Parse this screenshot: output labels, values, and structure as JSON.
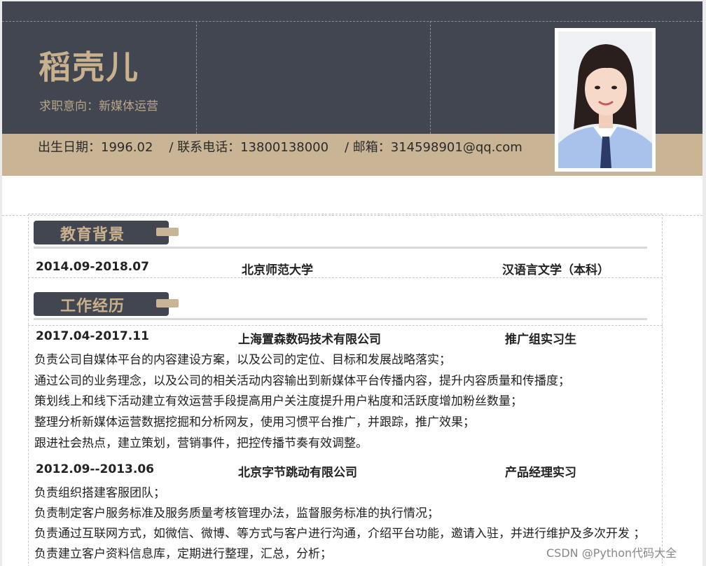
{
  "header": {
    "name": "稻壳儿",
    "intent": "求职意向：新媒体运营",
    "info": "出生日期：1996.02    / 联系电话：13800138000    / 邮箱：314598901@qq.com"
  },
  "education": {
    "title": "教育背景",
    "date": "2014.09-2018.07",
    "school": "北京师范大学",
    "major": "汉语言文学（本科）"
  },
  "work": {
    "title": "工作经历",
    "jobs": [
      {
        "date": "2017.04-2017.11",
        "company": "上海置森数码技术有限公司",
        "role": "推广组实习生",
        "lines": [
          "负责公司自媒体平台的内容建设方案，以及公司的定位、目标和发展战略落实；",
          "通过公司的业务理念，以及公司的相关活动内容输出到新媒体平台传播内容，提升内容质量和传播度；",
          "策划线上和线下活动建立有效运营手段提高用户关注度提升用户粘度和活跃度增加粉丝数量；",
          "整理分析新媒体运营数据挖掘和分析网友，使用习惯平台推广，并跟踪，推广效果；",
          "跟进社会热点，建立策划，营销事件，把控传播节奏有效调整。"
        ]
      },
      {
        "date": "2012.09--2013.06",
        "company": "北京字节跳动有限公司",
        "role": "产品经理实习",
        "lines": [
          "负责组织搭建客服团队；",
          "负责制定客户服务标准及服务质量考核管理办法，监督服务标准的执行情况；",
          "负责通过互联网方式，如微信、微博、等方式与客户进行沟通，介绍平台功能，邀请入驻，并进行维护及多次开发 ；",
          "负责建立客户资料信息库，定期进行整理，汇总，分析；"
        ]
      }
    ]
  },
  "watermark": "CSDN @Python代码大全",
  "colors": {
    "dark": "#414650",
    "gold": "#c9b595",
    "name_gold": "#c9b18d"
  }
}
